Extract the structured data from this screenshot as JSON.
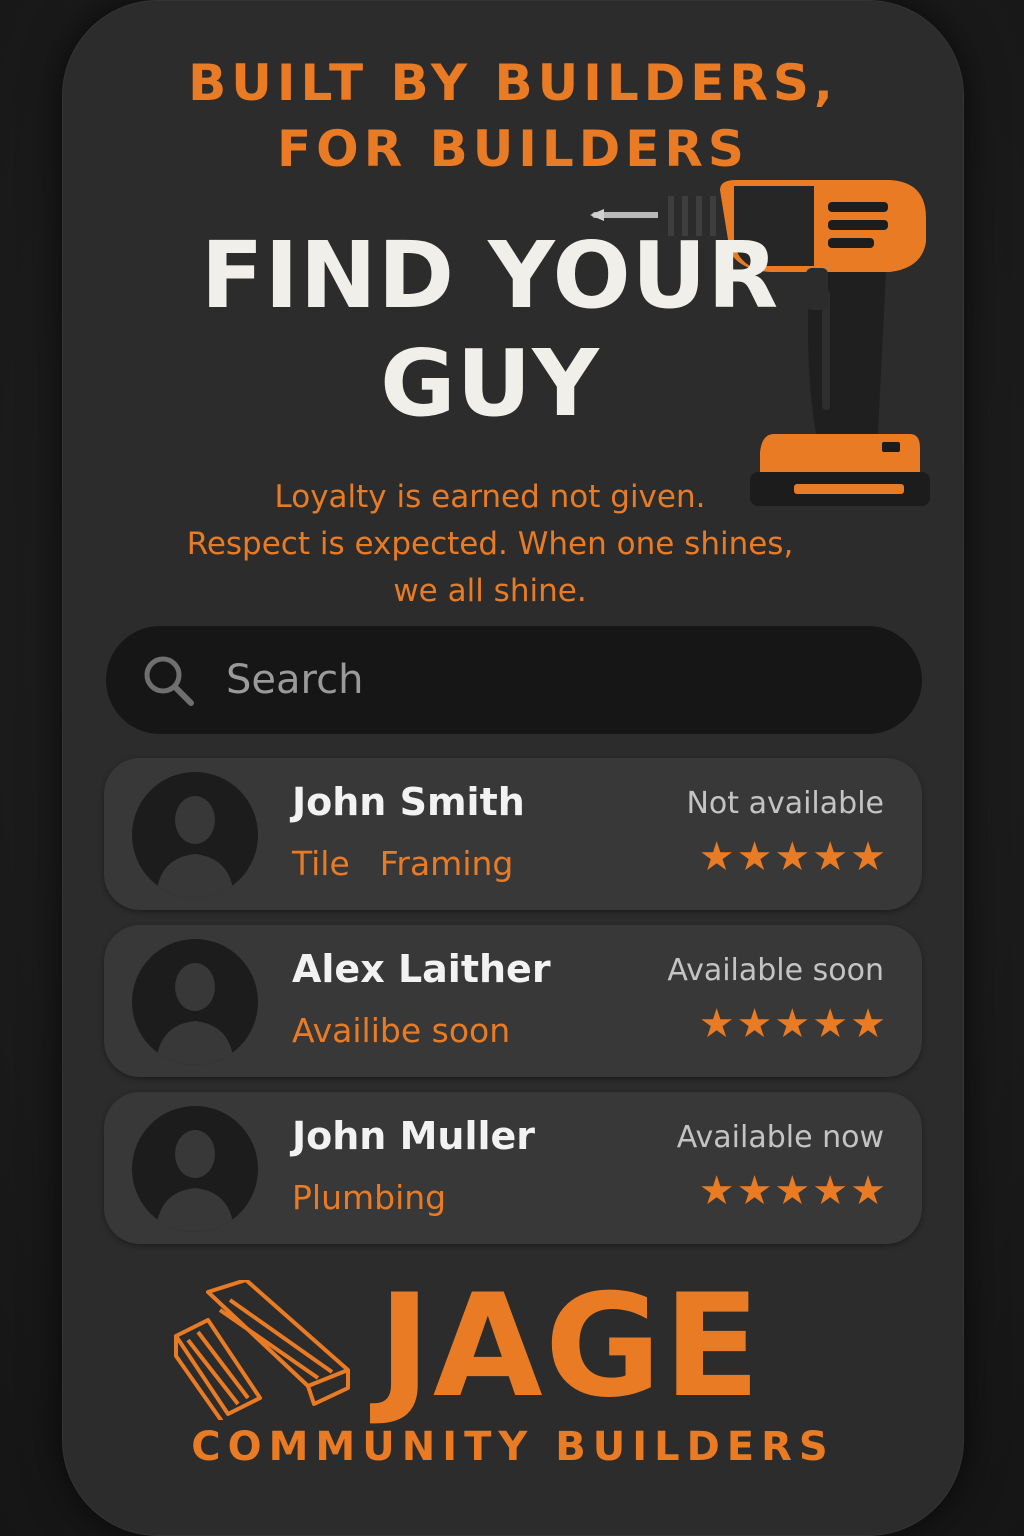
{
  "tagline": {
    "line1": "BUILT BY BUILDERS,",
    "line2": "FOR BUILDERS"
  },
  "headline": {
    "line1": "FIND YOUR",
    "line2": "GUY"
  },
  "motto": {
    "line1": "Loyalty is earned not given.",
    "line2": "Respect is expected. When one shines,",
    "line3": "we all shine."
  },
  "search": {
    "placeholder": "Search",
    "value": ""
  },
  "builders": [
    {
      "name": "John Smith",
      "skills": [
        "Tile",
        "Framing"
      ],
      "status": "Not available",
      "stars": "★★★★★",
      "rating": 5
    },
    {
      "name": "Alex Laither",
      "skills": [
        "Availibe soon"
      ],
      "status": "Available soon",
      "stars": "★★★★★",
      "rating": 5
    },
    {
      "name": "John Muller",
      "skills": [
        "Plumbing"
      ],
      "status": "Available now",
      "stars": "★★★★★",
      "rating": 5
    }
  ],
  "brand": {
    "name": "JAGE",
    "subtitle": "COMMUNITY BUILDERS"
  },
  "icons": {
    "search": "search-icon",
    "avatar": "person-silhouette-icon",
    "drill": "power-drill-icon",
    "logo": "wood-planks-icon"
  },
  "colors": {
    "accent": "#e97b24",
    "background": "#1e1e1e",
    "panel": "#2c2c2c",
    "card": "#383838",
    "searchbar": "#161616",
    "headline": "#f0efea"
  }
}
